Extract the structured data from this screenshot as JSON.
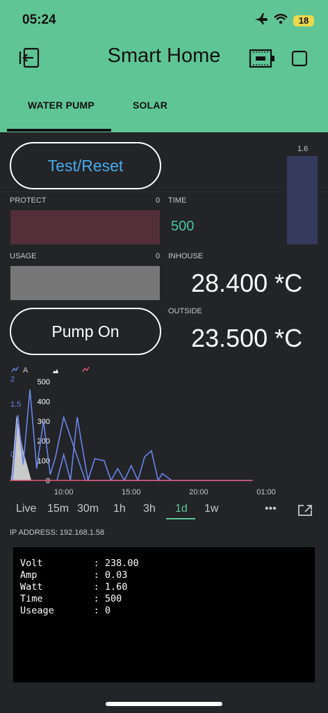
{
  "status": {
    "time": "05:24",
    "battery": "18"
  },
  "header": {
    "title": "Smart Home"
  },
  "tabs": [
    {
      "label": "WATER PUMP"
    },
    {
      "label": "SOLAR"
    }
  ],
  "widgets": {
    "test_reset": "Test/Reset",
    "vertical_bar": {
      "value": "1.6"
    },
    "protect": {
      "label": "PROTECT",
      "value": "0",
      "fill_color": "#532f38"
    },
    "time": {
      "label": "TIME",
      "value": "500",
      "value_color": "#4fc39a"
    },
    "usage": {
      "label": "USAGE",
      "value": "0",
      "fill_color": "#777777"
    },
    "inhouse": {
      "label": "INHOUSE",
      "value": "28.400 *C"
    },
    "pump_on": "Pump On",
    "outside": {
      "label": "OUTSIDE",
      "value": "23.500 *C"
    }
  },
  "chart_data": {
    "type": "line",
    "legend": [
      {
        "name": "A",
        "color": "#6b86e6"
      }
    ],
    "left_axis_ticks": [
      "2",
      "1.5",
      "0.5",
      "0"
    ],
    "right_axis_ticks": [
      "500",
      "400",
      "300",
      "200",
      "100",
      "0"
    ],
    "x_ticks": [
      "10:00",
      "15:00",
      "20:00",
      "01:00"
    ],
    "series": [
      {
        "color": "#6b86e6",
        "x": [
          6.2,
          6.6,
          7.0,
          7.5,
          8.0,
          8.5,
          9.0,
          9.4,
          10.0,
          11.6,
          12.6,
          13.6,
          14.0,
          14.6,
          15.0,
          15.4,
          16.4,
          16.8,
          18.0,
          24.0
        ],
        "values": [
          0,
          330,
          80,
          460,
          60,
          300,
          30,
          120,
          320,
          0,
          0,
          0,
          0,
          0,
          0,
          0,
          0,
          0,
          0,
          0
        ]
      },
      {
        "color": "#6b86e6",
        "x": [
          9.5,
          10.0,
          10.5,
          11.0,
          11.8,
          12.3,
          13.0,
          13.5,
          14.0,
          14.5,
          15.0,
          15.5,
          16.0,
          16.5,
          17.0,
          17.3,
          18.0
        ],
        "values": [
          0,
          130,
          0,
          320,
          0,
          110,
          100,
          0,
          60,
          0,
          75,
          0,
          120,
          150,
          0,
          35,
          0
        ]
      },
      {
        "color": "#e05a6e",
        "x": [
          6.0,
          24.0
        ],
        "values": [
          0,
          0
        ]
      }
    ],
    "ylim": [
      0,
      500
    ]
  },
  "ranges": {
    "items": [
      "Live",
      "15m",
      "30m",
      "1h",
      "3h",
      "1d",
      "1w"
    ],
    "active": "1d",
    "more": "•••"
  },
  "ip_address": "IP ADDRESS: 192.168.1.58",
  "terminal": {
    "rows": [
      {
        "key": "Volt",
        "value": "238.00"
      },
      {
        "key": "Amp",
        "value": "0.03"
      },
      {
        "key": "Watt",
        "value": "1.60"
      },
      {
        "key": "Time",
        "value": "500"
      },
      {
        "key": "Useage",
        "value": "0"
      }
    ],
    "separator": ":"
  }
}
